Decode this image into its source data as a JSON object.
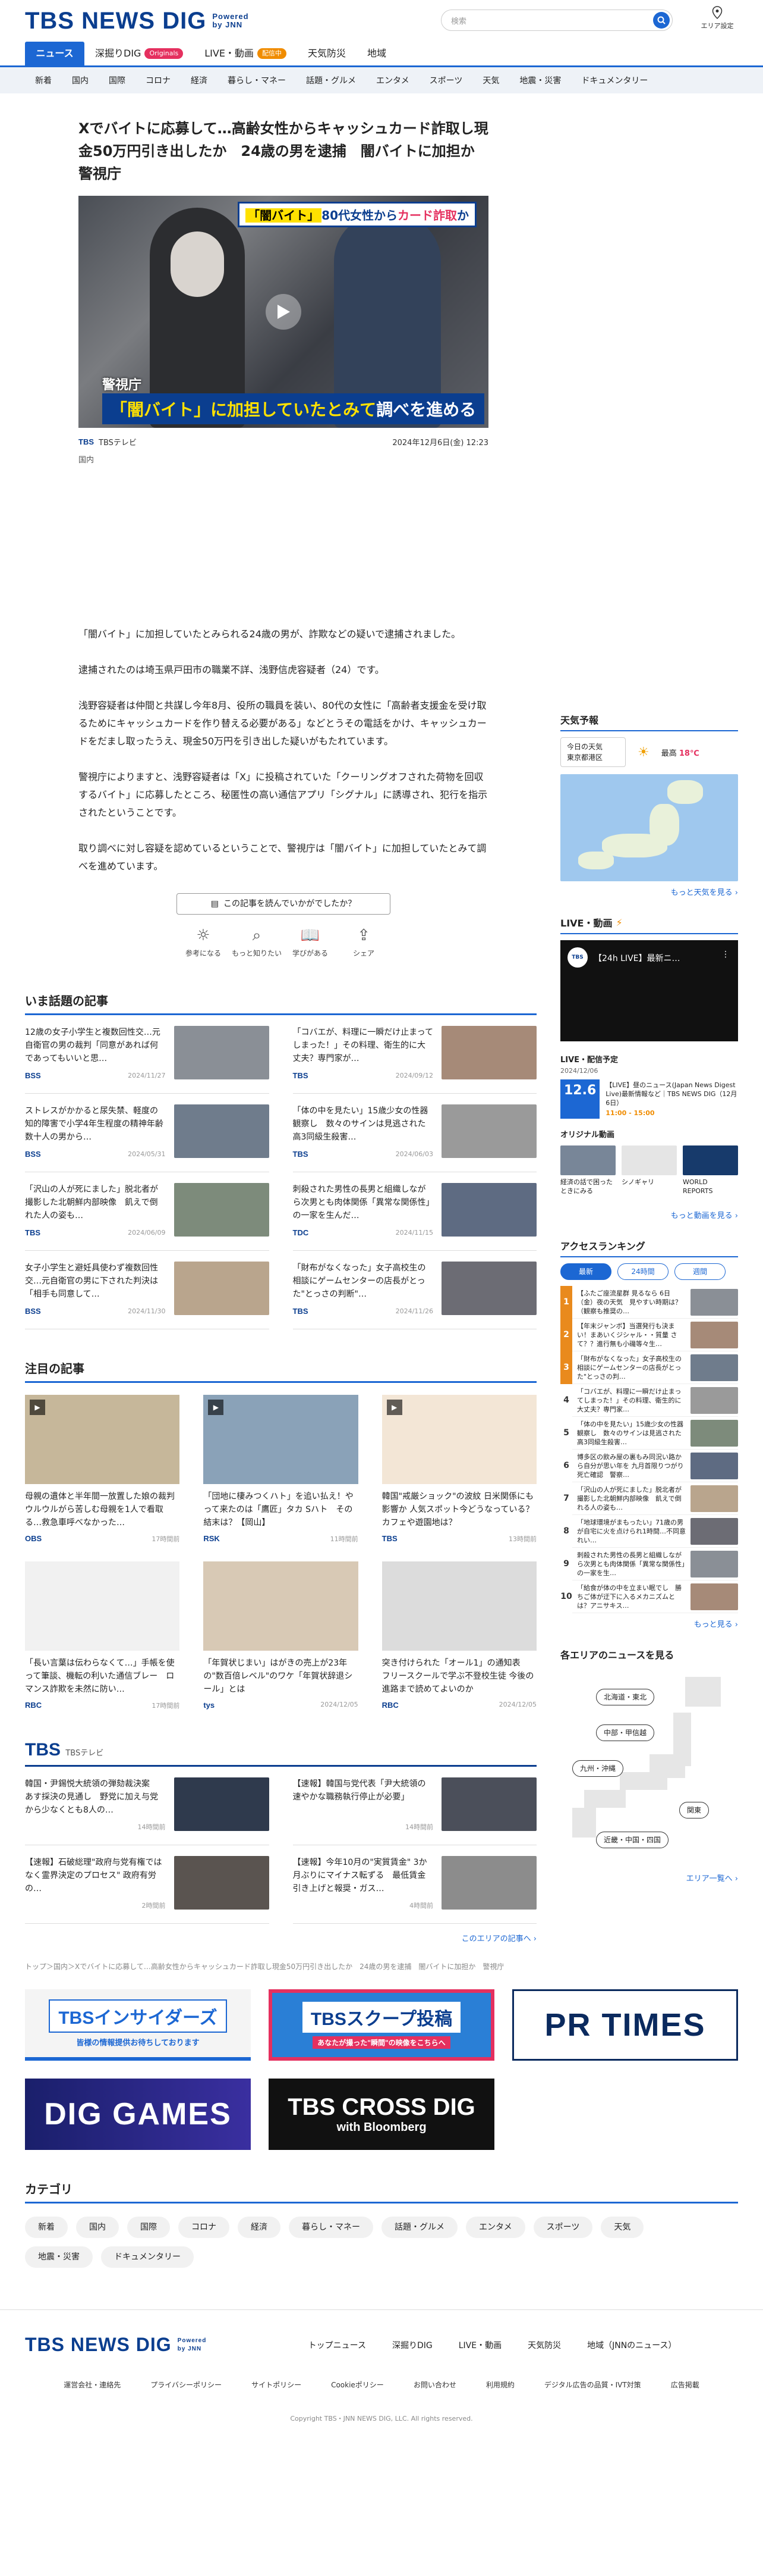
{
  "header": {
    "logo": "TBS NEWS DIG",
    "powered": "Powered by JNN",
    "search_placeholder": "検索",
    "area_setting": "エリア設定"
  },
  "nav": [
    {
      "label": "ニュース",
      "active": true
    },
    {
      "label": "深掘りDIG",
      "badge": "Originals"
    },
    {
      "label": "LIVE・動画",
      "badge": "配信中"
    },
    {
      "label": "天気防災"
    },
    {
      "label": "地域"
    }
  ],
  "subnav": [
    "新着",
    "国内",
    "国際",
    "コロナ",
    "経済",
    "暮らし・マネー",
    "話題・グルメ",
    "エンタメ",
    "スポーツ",
    "天気",
    "地震・災害",
    "ドキュメンタリー"
  ],
  "article": {
    "title": "Xでバイトに応募して…高齢女性からキャッシュカード詐取し現金50万円引き出したか　24歳の男を逮捕　闇バイトに加担か　警視庁",
    "hero": {
      "caption_top_1": "「闇バイト」",
      "caption_top_2": "80代女性から",
      "caption_top_3": "カード詐取",
      "caption_top_4": "か",
      "location": "警視庁",
      "caption_bottom_1": "「闇バイト」に加担していたとみて",
      "caption_bottom_2": "調べを進める"
    },
    "source_logo": "TBS",
    "source": "TBSテレビ",
    "date": "2024年12月6日(金) 12:23",
    "category": "国内",
    "paragraphs": [
      "「闇バイト」に加担していたとみられる24歳の男が、詐欺などの疑いで逮捕されました。",
      "逮捕されたのは埼玉県戸田市の職業不詳、浅野信虎容疑者（24）です。",
      "浅野容疑者は仲間と共謀し今年8月、役所の職員を装い、80代の女性に「高齢者支援金を受け取るためにキャッシュカードを作り替える必要がある」などとうその電話をかけ、キャッシュカードをだまし取ったうえ、現金50万円を引き出した疑いがもたれています。",
      "警視庁によりますと、浅野容疑者は「X」に投稿されていた「クーリングオフされた荷物を回収するバイト」に応募したところ、秘匿性の高い通信アプリ「シグナル」に誘導され、犯行を指示されたということです。",
      "取り調べに対し容疑を認めているということで、警視庁は「闇バイト」に加担していたとみて調べを進めています。"
    ],
    "feedback_q": "この記事を読んでいかがでしたか？",
    "feedback": [
      "参考になる",
      "もっと知りたい",
      "学びがある",
      "シェア"
    ]
  },
  "trending": {
    "title": "いま話題の記事",
    "items": [
      {
        "text": "12歳の女子小学生と複数回性交…元自衛官の男の裁判「同意があれば何であってもいいと思…",
        "src": "BSS",
        "date": "2024/11/27"
      },
      {
        "text": "「コバエが、料理に一瞬だけ止まってしまった！」その料理、衛生的に大丈夫？専門家が…",
        "src": "TBS",
        "date": "2024/09/12"
      },
      {
        "text": "ストレスがかかると尿失禁、軽度の知的障害で小学4年生程度の精神年齢　数十人の男から…",
        "src": "BSS",
        "date": "2024/05/31"
      },
      {
        "text": "「体の中を見たい」15歳少女の性器観察し　数々のサインは見逃された　高3同級生殺害…",
        "src": "TBS",
        "date": "2024/06/03"
      },
      {
        "text": "「沢山の人が死にました」脱北者が撮影した北朝鮮内部映像　飢えで倒れた人の姿も…",
        "src": "TBS",
        "date": "2024/06/09"
      },
      {
        "text": "刺殺された男性の長男と組織しながら次男とも肉体関係「異常な関係性」の一家を生んだ…",
        "src": "TDC",
        "date": "2024/11/15"
      },
      {
        "text": "女子小学生と避妊具使わず複数回性交…元自衛官の男に下された判決は「相手も同意して…",
        "src": "BSS",
        "date": "2024/11/30"
      },
      {
        "text": "「財布がなくなった」女子高校生の相談にゲームセンターの店長がとった\"とっさの判断\"…",
        "src": "TBS",
        "date": "2024/11/26"
      }
    ]
  },
  "featured": {
    "title": "注目の記事",
    "items": [
      {
        "text": "母親の遺体と半年間一放置した娘の裁判　ウルウルがら苦しむ母親を1人で看取る…救急車呼べなかった…",
        "src": "OBS",
        "date": "17時間前"
      },
      {
        "text": "「団地に棲みつくハト」を追い払え！やって来たのは「鷹匠」タカ Sハト　その結末は？【岡山】",
        "src": "RSK",
        "date": "11時間前"
      },
      {
        "text": "韓国\"戒厳ショック\"の波紋 日米関係にも影響か 人気スポット今どうなっている？カフェや遊園地は？",
        "src": "TBS",
        "date": "13時間前"
      },
      {
        "text": "「長い言葉は伝わらなくて…」手帳を使って筆談、機転の利いた通信ブレー　ロマンス詐欺を未然に防い…",
        "src": "RBC",
        "date": "17時間前"
      },
      {
        "text": "「年賀状じまい」はがきの売上が23年の\"数百倍レベル\"のワケ「年賀状辞退シール」とは",
        "src": "tys",
        "date": "2024/12/05"
      },
      {
        "text": "突き付けられた「オール1」の通知表　フリースクールで学ぶ不登校生徒 今後の進路まで読めてよいのか",
        "src": "RBC",
        "date": "2024/12/05"
      }
    ]
  },
  "tbs_section": {
    "title": "TBS",
    "sub": "TBSテレビ",
    "items": [
      {
        "text": "韓国・尹錫悦大統領の弾劾裁決案　あす採決の見通し　野党に加え与党から少なくとも8人の…",
        "date": "14時間前"
      },
      {
        "text": "【速報】韓国与党代表「尹大統領の速やかな職務執行停止が必要」",
        "date": "14時間前"
      },
      {
        "text": "【速報】石破総理\"政府与党有権ではなく霊界決定のプロセス\" 政府有労の…",
        "date": "2時間前"
      },
      {
        "text": "【速報】今年10月の\"実質賃金\" 3か月ぶりにマイナス転ずる　最低賃金引き上げと報奨・ガス…",
        "date": "4時間前"
      }
    ],
    "more": "このエリアの記事へ"
  },
  "breadcrumb": "トップ＞国内＞Xでバイトに応募して…高齢女性からキャッシュカード詐取し現金50万円引き出したか　24歳の男を逮捕　闇バイトに加担か　警視庁",
  "banners": [
    {
      "label": "TBSインサイダーズ",
      "sub": "皆様の情報提供お待ちしております"
    },
    {
      "label": "TBSスクープ投稿",
      "sub": "あなたが撮った\"瞬間\"の映像をこちらへ"
    },
    {
      "label": "PR TIMES"
    },
    {
      "label": "DIG GAMES"
    },
    {
      "label": "TBS CROSS DIG",
      "sub": "with Bloomberg"
    }
  ],
  "categories": {
    "title": "カテゴリ",
    "items": [
      "新着",
      "国内",
      "国際",
      "コロナ",
      "経済",
      "暮らし・マネー",
      "話題・グルメ",
      "エンタメ",
      "スポーツ",
      "天気",
      "地震・災害",
      "ドキュメンタリー"
    ]
  },
  "sidebar": {
    "weather": {
      "title": "天気予報",
      "place_1": "今日の天気",
      "place_2": "東京都港区",
      "high_label": "最高",
      "high": "18℃",
      "more": "もっと天気を見る"
    },
    "live": {
      "title": "LIVE・動画",
      "video_title": "【24h LIVE】最新ニ…",
      "schedule_title": "LIVE・配信予定",
      "schedule_date": "2024/12/06",
      "sched_date_big": "12.6",
      "sched_text": "【LIVE】昼のニュース(Japan News Digest Live)最新情報など｜TBS NEWS DIG（12月6日）",
      "sched_time": "11:00 - 15:00",
      "original_title": "オリジナル動画",
      "originals": [
        "経済の話で困ったときにみる",
        "シノギャリ",
        "WORLD REPORTS"
      ],
      "more": "もっと動画を見る"
    },
    "ranking": {
      "title": "アクセスランキング",
      "tabs": [
        "最新",
        "24時間",
        "週間"
      ],
      "items": [
        "【ふたご座流星群 見るなら 6日（金）夜の天気　見やすい時期は？（観察も推奨の…",
        "【年末ジャンボ】当選発行も決まい！まあいくジシャル・・質量 さて？？進行無も小磯等々生…",
        "「財布がなくなった」女子高校生の相談にゲームセンターの店長がとった\"とっさの判…",
        "「コバエが、料理に一瞬だけ止まってしまった！」その料理、衛生的に大丈夫？専門家…",
        "「体の中を見たい」15歳少女の性器観察し　数々のサインは見逃された　高3同級生殺害…",
        "博多区の飲み屋の裏もみ同況い路から自分が思い年を 九月首限りつがり死亡確認　警察…",
        "「沢山の人が死にました」脱北者が撮影した北朝鮮内部映像　飢えで倒れる人の姿も…",
        "「地球環境がまもったい」71歳の男が自宅に火を点けられ1時間…不同意れい…",
        "刺殺された男性の長男と組織しながら次男とも肉体関係「異常な関係性」の一家を生…",
        "「給食が体の中を立まい眠でし　勝ちご体が迂下に入るメカニズムとは？アニサキス…"
      ],
      "more": "もっと見る"
    },
    "areas": {
      "title": "各エリアのニュースを見る",
      "buttons": [
        "北海道・東北",
        "中部・甲信越",
        "九州・沖縄",
        "関東",
        "近畿・中国・四国"
      ],
      "more": "エリア一覧へ"
    }
  },
  "footer": {
    "logo": "TBS NEWS DIG",
    "links": [
      "トップニュース",
      "深掘りDIG",
      "LIVE・動画",
      "天気防災",
      "地域（JNNのニュース）"
    ],
    "sub_links": [
      "運営会社・連絡先",
      "プライバシーポリシー",
      "サイトポリシー",
      "Cookieポリシー",
      "お問い合わせ",
      "利用規約",
      "デジタル広告の品質・IVT対策",
      "広告掲載"
    ],
    "copyright": "Copyright TBS・JNN NEWS DIG, LLC. All rights reserved."
  },
  "colors": {
    "brand": "#0b3e8f",
    "accent": "#1c67d3",
    "alert": "#e5305f",
    "rank": "#e98a1d"
  }
}
